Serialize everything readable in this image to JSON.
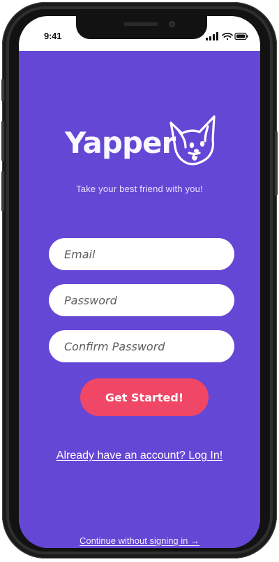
{
  "status_bar": {
    "time": "9:41",
    "icons": [
      "signal-icon",
      "wifi-icon",
      "battery-icon"
    ]
  },
  "brand": {
    "name": "Yapper",
    "logo_icon": "dog-head-icon"
  },
  "tagline": "Take your best friend with you!",
  "form": {
    "email_placeholder": "Email",
    "password_placeholder": "Password",
    "confirm_password_placeholder": "Confirm Password",
    "submit_label": "Get Started!"
  },
  "links": {
    "login": "Already have an account? Log In!",
    "guest": "Continue without signing in →"
  },
  "colors": {
    "background": "#6547d6",
    "primary_button": "#f04766",
    "text_light": "#ffffff",
    "device_frame": "#121212"
  }
}
